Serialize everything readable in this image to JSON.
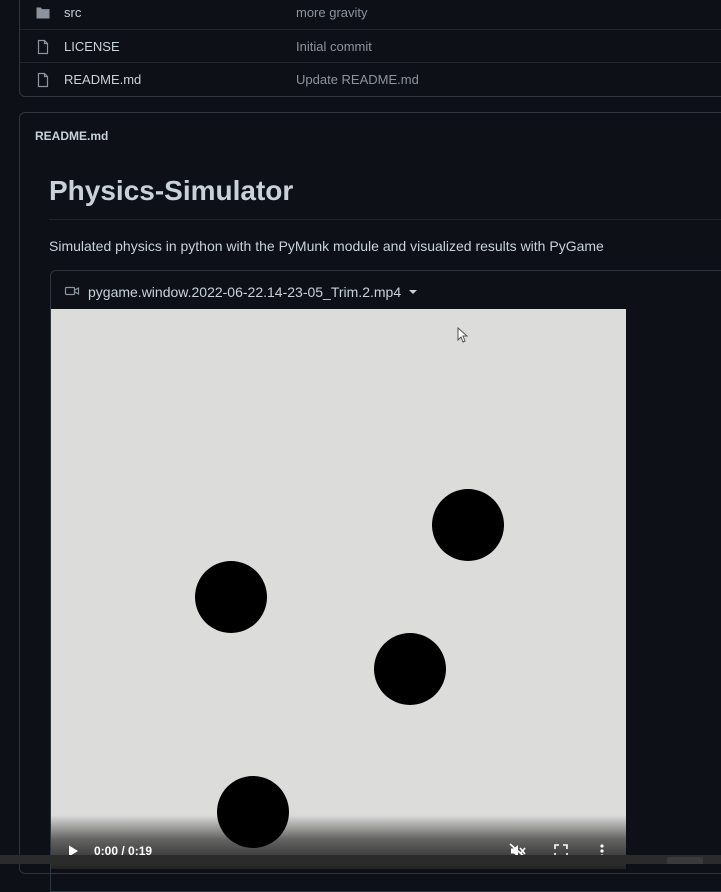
{
  "files": [
    {
      "name": "src",
      "type": "folder",
      "commit": "more gravity"
    },
    {
      "name": "LICENSE",
      "type": "file",
      "commit": "Initial commit"
    },
    {
      "name": "README.md",
      "type": "file",
      "commit": "Update README.md"
    }
  ],
  "readme": {
    "header": "README.md",
    "title": "Physics-Simulator",
    "description": "Simulated physics in python with the PyMunk module and visualized results with PyGame",
    "video": {
      "filename": "pygame.window.2022-06-22.14-23-05_Trim.2.mp4",
      "time": "0:00 / 0:19",
      "ball_count": 4
    }
  },
  "icons": {
    "folder": "folder-icon",
    "file": "file-icon",
    "video": "video-camera-icon",
    "play": "play-icon",
    "mute": "muted-speaker-icon",
    "fullscreen": "fullscreen-icon",
    "more": "more-vertical-icon"
  },
  "colors": {
    "background": "#0d1117",
    "border": "#30363d",
    "text": "#c9d1d9",
    "muted_text": "#8b949e",
    "video_bg": "#dcdcdb"
  }
}
